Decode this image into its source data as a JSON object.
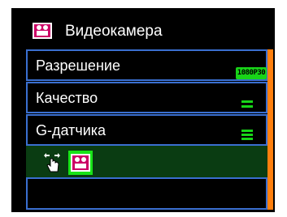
{
  "header": {
    "title": "Видеокамера",
    "icon": "video-camera-icon"
  },
  "menu": {
    "items": [
      {
        "label": "Разрешение",
        "value": "1080P30",
        "value_icon": "resolution-badge"
      },
      {
        "label": "Качество",
        "value_icon": "quality-bars-icon"
      },
      {
        "label": "G-датчика",
        "value_icon": "g-sensor-bars-icon"
      }
    ],
    "bottom_icons": [
      "hand-touch-icon",
      "video-camera-icon"
    ]
  },
  "colors": {
    "screen_bg": "#000000",
    "row_border": "#3a6fd0",
    "accent_green": "#18d418",
    "selected_row_bg": "#0a3c12",
    "scrollbar": "#ff7f0e",
    "icon_magenta": "#cc0066"
  }
}
